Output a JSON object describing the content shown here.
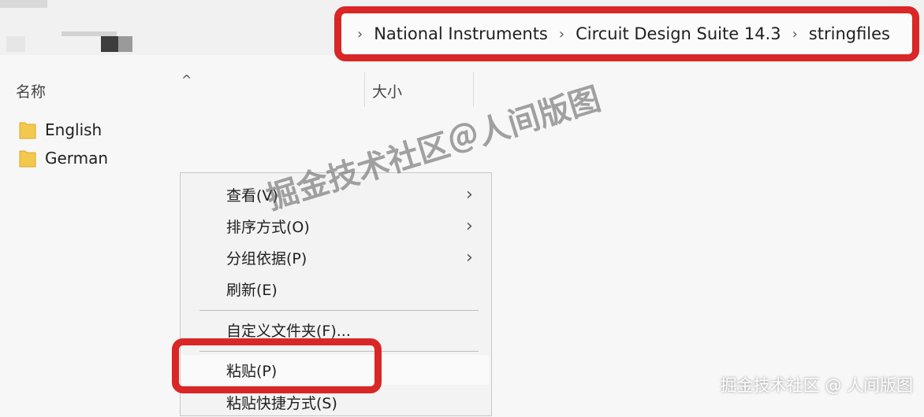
{
  "address_bar": {
    "crumbs": [
      "National Instruments",
      "Circuit Design Suite 14.3",
      "stringfiles"
    ]
  },
  "column_header": {
    "name_label": "名称",
    "size_label": "大小"
  },
  "files": [
    {
      "name": "English",
      "icon": "folder-icon"
    },
    {
      "name": "German",
      "icon": "folder-icon"
    }
  ],
  "context_menu": {
    "items": [
      {
        "label": "查看(V)",
        "has_submenu": true
      },
      {
        "label": "排序方式(O)",
        "has_submenu": true
      },
      {
        "label": "分组依据(P)",
        "has_submenu": true
      },
      {
        "label": "刷新(E)",
        "has_submenu": false
      },
      {
        "label": "自定义文件夹(F)...",
        "has_submenu": false
      },
      {
        "label": "粘贴(P)",
        "has_submenu": false
      },
      {
        "label": "粘贴快捷方式(S)",
        "has_submenu": false
      }
    ]
  },
  "watermark": {
    "main": "掘金技术社区＠人间版图",
    "corner": "掘金技术社区 @ 人间版图"
  },
  "colors": {
    "highlight": "#d92626",
    "folder": "#f2c94c"
  }
}
